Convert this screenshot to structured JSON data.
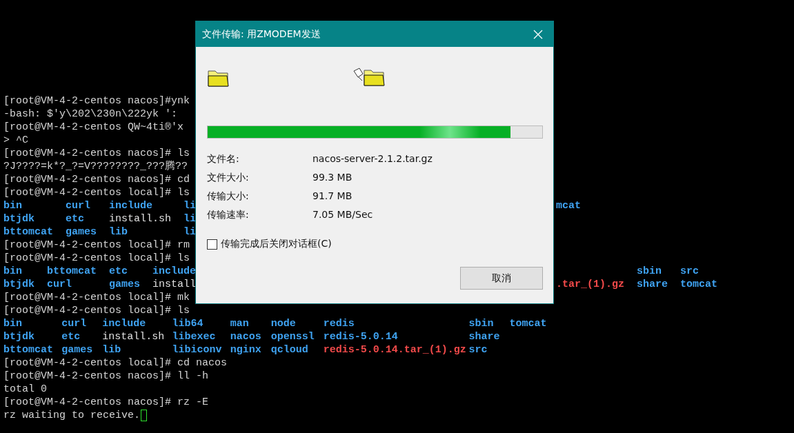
{
  "terminal": {
    "blocks": [
      {
        "kind": "text",
        "text": "[root@VM-4-2-centos nacos]#ynk"
      },
      {
        "kind": "text",
        "text": "-bash: $'y\\202\\230n\\222yk ':"
      },
      {
        "kind": "text",
        "text": "[root@VM-4-2-centos QW~4ti®'x"
      },
      {
        "kind": "text",
        "text": "> ^C"
      },
      {
        "kind": "text",
        "text": "[root@VM-4-2-centos nacos]# ls"
      },
      {
        "kind": "text",
        "text": "?J????=k*?_?=V????????_???腾??"
      },
      {
        "kind": "text",
        "text": "[root@VM-4-2-centos nacos]# cd"
      },
      {
        "kind": "text",
        "text": "[root@VM-4-2-centos local]# ls"
      },
      {
        "kind": "listing",
        "columns": [
          [
            {
              "text": "bin",
              "kind": "dir"
            },
            {
              "text": "btjdk",
              "kind": "dir"
            },
            {
              "text": "bttomcat",
              "kind": "dir"
            }
          ],
          [
            {
              "text": "curl",
              "kind": "dir"
            },
            {
              "text": "etc",
              "kind": "dir"
            },
            {
              "text": "games",
              "kind": "dir"
            }
          ],
          [
            {
              "text": "include",
              "kind": "dir"
            },
            {
              "text": "install.sh",
              "kind": "file"
            },
            {
              "text": "lib",
              "kind": "dir"
            }
          ],
          [
            {
              "text": "li",
              "kind": "dir"
            },
            {
              "text": "li",
              "kind": "dir"
            },
            {
              "text": "li",
              "kind": "dir"
            }
          ]
        ],
        "right_columns": [
          [
            {
              "text": "mcat",
              "kind": "dir"
            },
            null,
            null
          ]
        ]
      },
      {
        "kind": "text",
        "text": "[root@VM-4-2-centos local]# rm"
      },
      {
        "kind": "text",
        "text": "[root@VM-4-2-centos local]# ls"
      },
      {
        "kind": "listing",
        "columns": [
          [
            {
              "text": "bin",
              "kind": "dir"
            },
            {
              "text": "btjdk",
              "kind": "dir"
            }
          ],
          [
            {
              "text": "bttomcat",
              "kind": "dir"
            },
            {
              "text": "curl",
              "kind": "dir"
            }
          ],
          [
            {
              "text": "etc",
              "kind": "dir"
            },
            {
              "text": "games",
              "kind": "dir"
            }
          ],
          [
            {
              "text": "include",
              "kind": "dir"
            },
            {
              "text": "install",
              "kind": "file"
            }
          ]
        ],
        "right_columns": [
          [
            null,
            {
              "text": ".tar_(1).gz",
              "kind": "archive"
            }
          ],
          [
            {
              "text": "sbin",
              "kind": "dir"
            },
            {
              "text": "share",
              "kind": "dir"
            }
          ],
          [
            {
              "text": "src",
              "kind": "dir"
            },
            {
              "text": "tomcat",
              "kind": "dir"
            }
          ]
        ]
      },
      {
        "kind": "text",
        "text": "[root@VM-4-2-centos local]# mk"
      },
      {
        "kind": "text",
        "text": "[root@VM-4-2-centos local]# ls"
      },
      {
        "kind": "listing",
        "columns": [
          [
            {
              "text": "bin",
              "kind": "dir"
            },
            {
              "text": "btjdk",
              "kind": "dir"
            },
            {
              "text": "bttomcat",
              "kind": "dir"
            }
          ],
          [
            {
              "text": "curl",
              "kind": "dir"
            },
            {
              "text": "etc",
              "kind": "dir"
            },
            {
              "text": "games",
              "kind": "dir"
            }
          ],
          [
            {
              "text": "include",
              "kind": "dir"
            },
            {
              "text": "install.sh",
              "kind": "file"
            },
            {
              "text": "lib",
              "kind": "dir"
            }
          ],
          [
            {
              "text": "lib64",
              "kind": "dir"
            },
            {
              "text": "libexec",
              "kind": "dir"
            },
            {
              "text": "libiconv",
              "kind": "dir"
            }
          ],
          [
            {
              "text": "man",
              "kind": "dir"
            },
            {
              "text": "nacos",
              "kind": "dir"
            },
            {
              "text": "nginx",
              "kind": "dir"
            }
          ],
          [
            {
              "text": "node",
              "kind": "dir"
            },
            {
              "text": "openssl",
              "kind": "dir"
            },
            {
              "text": "qcloud",
              "kind": "dir"
            }
          ],
          [
            {
              "text": "redis",
              "kind": "dir"
            },
            {
              "text": "redis-5.0.14",
              "kind": "dir"
            },
            {
              "text": "redis-5.0.14.tar_(1).gz",
              "kind": "archive"
            }
          ],
          [
            {
              "text": "sbin",
              "kind": "dir"
            },
            {
              "text": "share",
              "kind": "dir"
            },
            {
              "text": "src",
              "kind": "dir"
            }
          ],
          [
            {
              "text": "tomcat",
              "kind": "dir"
            },
            null,
            null
          ]
        ]
      },
      {
        "kind": "text",
        "text": "[root@VM-4-2-centos local]# cd nacos"
      },
      {
        "kind": "text",
        "text": "[root@VM-4-2-centos nacos]# ll -h"
      },
      {
        "kind": "text",
        "text": "total 0"
      },
      {
        "kind": "text",
        "text": "[root@VM-4-2-centos nacos]# rz -E"
      },
      {
        "kind": "text",
        "text": "rz waiting to receive.",
        "cursor": true
      }
    ]
  },
  "dialog": {
    "title": "文件传输: 用ZMODEM发送",
    "progress": {
      "level": 0.906
    },
    "fields": [
      {
        "label": "文件名:",
        "value": "nacos-server-2.1.2.tar.gz"
      },
      {
        "label": "文件大小:",
        "value": "99.3 MB"
      },
      {
        "label": "传输大小:",
        "value": "91.7 MB"
      },
      {
        "label": "传输速率:",
        "value": "7.05 MB/Sec"
      }
    ],
    "close_when_done": {
      "label": "传输完成后关闭对话框(C)",
      "checked": false
    },
    "buttons": [
      "取消"
    ]
  }
}
